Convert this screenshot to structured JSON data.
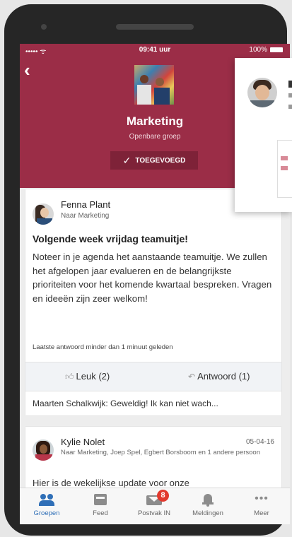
{
  "status_bar": {
    "signal": "••••• ᯤ",
    "time": "09:41 uur",
    "battery": "100%"
  },
  "group": {
    "name": "Marketing",
    "type": "Openbare groep",
    "joined_label": "TOEGEVOEGD"
  },
  "posts": [
    {
      "author": "Fenna Plant",
      "target": "Naar Marketing",
      "title": "Volgende week vrijdag teamuitje!",
      "body": "Noteer in je agenda het aanstaande teamuitje. We zullen het afgelopen jaar evalueren en de belangrijkste prioriteiten voor het komende kwartaal bespreken. Vragen en ideeën zijn zeer welkom!",
      "last_reply": "Laatste antwoord minder dan 1 minuut geleden",
      "like_label": "Leuk (2)",
      "reply_label": "Antwoord (1)",
      "comment": "Maarten Schalkwijk: Geweldig! Ik kan niet wach..."
    },
    {
      "author": "Kylie Nolet",
      "date": "05-04-16",
      "target": "Naar Marketing, Joep Spel, Egbert Borsboom en 1 andere persoon",
      "preview": "Hier is de wekelijkse update voor onze"
    }
  ],
  "tabs": [
    {
      "label": "Groepen",
      "icon": "people-icon",
      "active": true
    },
    {
      "label": "Feed",
      "icon": "feed-icon"
    },
    {
      "label": "Postvak IN",
      "icon": "mail-icon",
      "badge": "8"
    },
    {
      "label": "Meldingen",
      "icon": "bell-icon"
    },
    {
      "label": "Meer",
      "icon": "more-icon",
      "glyph": "•••"
    }
  ],
  "colors": {
    "header": "#9b2d47",
    "active_tab": "#2f6fb7",
    "badge": "#e23a2f"
  }
}
